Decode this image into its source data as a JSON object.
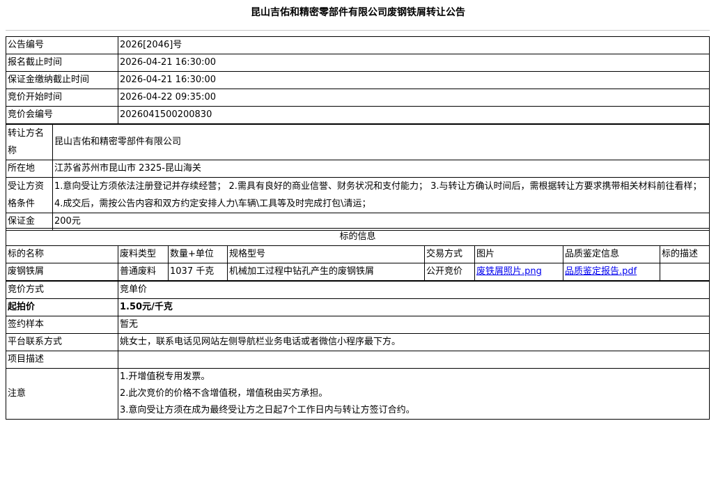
{
  "title": "昆山吉佑和精密零部件有限公司废钢铁屑转让公告",
  "info": [
    {
      "label": "公告编号",
      "value": "2026[2046]号"
    },
    {
      "label": "报名截止时间",
      "value": "2026-04-21 16:30:00"
    },
    {
      "label": "保证金缴纳截止时间",
      "value": "2026-04-21 16:30:00"
    },
    {
      "label": "竞价开始时间",
      "value": "2026-04-22 09:35:00"
    },
    {
      "label": "竞价会编号",
      "value": "2026041500200830"
    }
  ],
  "transferor": {
    "name_label": "转让方名称",
    "name_value": "昆山吉佑和精密零部件有限公司",
    "location_label": "所在地",
    "location_value": "江苏省苏州市昆山市 2325-昆山海关",
    "qualification_label": "受让方资格条件",
    "qualification_value": "1.意向受让方须依法注册登记并存续经营； 2.需具有良好的商业信誉、财务状况和支付能力； 3.与转让方确认时间后，需根据转让方要求携带相关材料前往看样； 4.成交后，需按公告内容和双方约定安排人力\\车辆\\工具等及时完成打包\\清运；",
    "deposit_label": "保证金",
    "deposit_value": "200元"
  },
  "lot": {
    "section_title": "标的信息",
    "headers": [
      "标的名称",
      "废料类型",
      "数量+单位",
      "规格型号",
      "交易方式",
      "图片",
      "品质鉴定信息",
      "标的描述"
    ],
    "row": {
      "name": "废钢铁屑",
      "type": "普通废料",
      "quantity": "1037 千克",
      "spec": "机械加工过程中钻孔产生的废钢铁屑",
      "method": "公开竞价",
      "image_link": "废铁屑照片.png",
      "quality_link": "品质鉴定报告.pdf",
      "description": ""
    }
  },
  "bidding": {
    "method_label": "竞价方式",
    "method_value": "竞单价",
    "start_price_label": "起拍价",
    "start_price_value": "1.50元/千克",
    "contract_label": "签约样本",
    "contract_value": "暂无",
    "contact_label": "平台联系方式",
    "contact_value": "姚女士，联系电话见网站左侧导航栏业务电话或者微信小程序最下方。",
    "project_label": "项目描述",
    "project_value": "",
    "notes_label": "注意",
    "notes": [
      "1.开增值税专用发票。",
      "2.此次竞价的价格不含增值税，增值税由买方承担。",
      "3.意向受让方须在成为最终受让方之日起7个工作日内与转让方签订合约。"
    ]
  }
}
